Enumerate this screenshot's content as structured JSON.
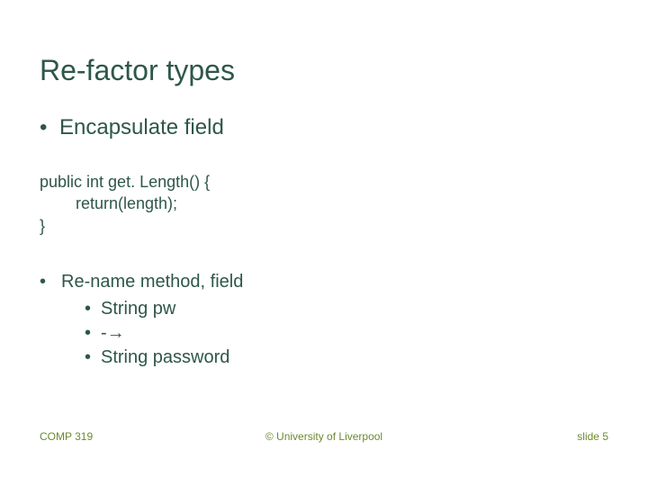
{
  "title": "Re-factor types",
  "bullets": {
    "b1": "Encapsulate field",
    "b2": "Re-name method, field",
    "sub": {
      "s1": "String pw",
      "s2": "-→",
      "s3": "String password"
    }
  },
  "code": {
    "l1": "public int get. Length() {",
    "l2": "return(length);",
    "l3": "}"
  },
  "footer": {
    "left": "COMP 319",
    "center": "© University of Liverpool",
    "right_prefix": "slide ",
    "right_num": "5"
  },
  "bullet_glyph": "•"
}
